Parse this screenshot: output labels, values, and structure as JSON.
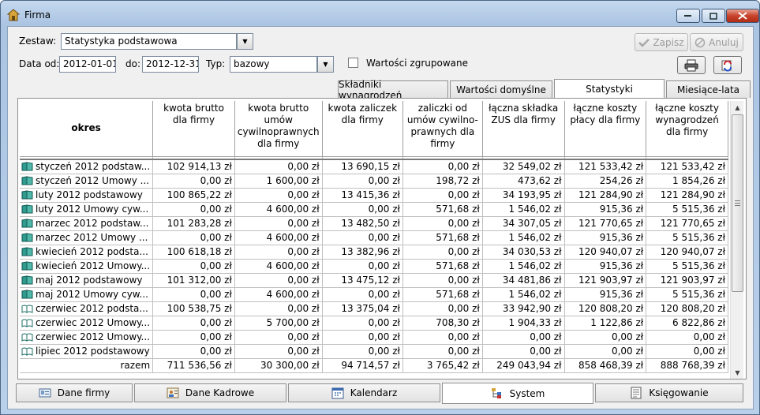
{
  "window": {
    "title": "Firma"
  },
  "form": {
    "zestaw_label": "Zestaw:",
    "zestaw_value": "Statystyka podstawowa",
    "data_od_label": "Data od:",
    "data_od_value": "2012-01-01",
    "do_label": "do:",
    "do_value": "2012-12-31",
    "typ_label": "Typ:",
    "typ_value": "bazowy",
    "grouped_label": "Wartości zgrupowane",
    "zapisz_label": "Zapisz",
    "anuluj_label": "Anuluj"
  },
  "top_tabs": [
    "Składniki wynagrodzeń",
    "Wartości domyślne",
    "Statystyki",
    "Miesiące-lata"
  ],
  "table": {
    "headers": [
      "okres",
      "kwota brutto dla firmy",
      "kwota brutto umów cywilnoprawnych dla firmy",
      "kwota zaliczek dla firmy",
      "zaliczki od umów cywilno-prawnych dla firmy",
      "łączna składka ZUS dla firmy",
      "łączne koszty płacy dla firmy",
      "łączne koszty wynagrodzeń dla firmy"
    ],
    "rows": [
      {
        "name": "styczeń 2012 podstaw...",
        "icon": "book-green",
        "cells": [
          "102 914,13 zł",
          "0,00 zł",
          "13 690,15 zł",
          "0,00 zł",
          "32 549,02 zł",
          "121 533,42 zł",
          "121 533,42 zł"
        ]
      },
      {
        "name": "styczeń 2012 Umowy ...",
        "icon": "book-green",
        "cells": [
          "0,00 zł",
          "1 600,00 zł",
          "0,00 zł",
          "198,72 zł",
          "473,62 zł",
          "254,26 zł",
          "1 854,26 zł"
        ]
      },
      {
        "name": "luty 2012 podstawowy",
        "icon": "book-green",
        "cells": [
          "100 865,22 zł",
          "0,00 zł",
          "13 415,36 zł",
          "0,00 zł",
          "34 193,95 zł",
          "121 284,90 zł",
          "121 284,90 zł"
        ]
      },
      {
        "name": "luty 2012 Umowy cyw...",
        "icon": "book-green",
        "cells": [
          "0,00 zł",
          "4 600,00 zł",
          "0,00 zł",
          "571,68 zł",
          "1 546,02 zł",
          "915,36 zł",
          "5 515,36 zł"
        ]
      },
      {
        "name": "marzec 2012 podstaw...",
        "icon": "book-green",
        "cells": [
          "101 283,28 zł",
          "0,00 zł",
          "13 482,50 zł",
          "0,00 zł",
          "34 307,05 zł",
          "121 770,65 zł",
          "121 770,65 zł"
        ]
      },
      {
        "name": "marzec 2012 Umowy ...",
        "icon": "book-green",
        "cells": [
          "0,00 zł",
          "4 600,00 zł",
          "0,00 zł",
          "571,68 zł",
          "1 546,02 zł",
          "915,36 zł",
          "5 515,36 zł"
        ]
      },
      {
        "name": "kwiecień 2012 podsta...",
        "icon": "book-green",
        "cells": [
          "100 618,18 zł",
          "0,00 zł",
          "13 382,96 zł",
          "0,00 zł",
          "34 030,53 zł",
          "120 940,07 zł",
          "120 940,07 zł"
        ]
      },
      {
        "name": "kwiecień 2012 Umowy...",
        "icon": "book-green",
        "cells": [
          "0,00 zł",
          "4 600,00 zł",
          "0,00 zł",
          "571,68 zł",
          "1 546,02 zł",
          "915,36 zł",
          "5 515,36 zł"
        ]
      },
      {
        "name": "maj 2012 podstawowy",
        "icon": "book-green",
        "cells": [
          "101 312,00 zł",
          "0,00 zł",
          "13 475,12 zł",
          "0,00 zł",
          "34 481,86 zł",
          "121 903,97 zł",
          "121 903,97 zł"
        ]
      },
      {
        "name": "maj 2012 Umowy cyw...",
        "icon": "book-green",
        "cells": [
          "0,00 zł",
          "4 600,00 zł",
          "0,00 zł",
          "571,68 zł",
          "1 546,02 zł",
          "915,36 zł",
          "5 515,36 zł"
        ]
      },
      {
        "name": "czerwiec 2012 podsta...",
        "icon": "book-open",
        "cells": [
          "100 538,75 zł",
          "0,00 zł",
          "13 375,04 zł",
          "0,00 zł",
          "33 942,90 zł",
          "120 808,20 zł",
          "120 808,20 zł"
        ]
      },
      {
        "name": "czerwiec 2012 Umowy...",
        "icon": "book-open",
        "cells": [
          "0,00 zł",
          "5 700,00 zł",
          "0,00 zł",
          "708,30 zł",
          "1 904,33 zł",
          "1 122,86 zł",
          "6 822,86 zł"
        ]
      },
      {
        "name": "czerwiec 2012 Umowy...",
        "icon": "book-open",
        "cells": [
          "0,00 zł",
          "0,00 zł",
          "0,00 zł",
          "0,00 zł",
          "0,00 zł",
          "0,00 zł",
          "0,00 zł"
        ]
      },
      {
        "name": "lipiec 2012 podstawowy",
        "icon": "book-open",
        "cells": [
          "0,00 zł",
          "0,00 zł",
          "0,00 zł",
          "0,00 zł",
          "0,00 zł",
          "0,00 zł",
          "0,00 zł"
        ]
      }
    ],
    "total": {
      "label": "razem",
      "cells": [
        "711 536,56 zł",
        "30 300,00 zł",
        "94 714,57 zł",
        "3 765,42 zł",
        "249 043,94 zł",
        "858 468,39 zł",
        "888 768,39 zł"
      ]
    }
  },
  "bottom_tabs": [
    {
      "label": "Dane firmy",
      "icon": "id-card-icon"
    },
    {
      "label": "Dane Kadrowe",
      "icon": "people-card-icon"
    },
    {
      "label": "Kalendarz",
      "icon": "calendar-icon"
    },
    {
      "label": "System",
      "icon": "system-tree-icon"
    },
    {
      "label": "Księgowanie",
      "icon": "ledger-icon"
    }
  ],
  "colors": {
    "accent": "#3b7fc4",
    "book_green": "#2e9b8e",
    "close_red": "#c8432c"
  }
}
